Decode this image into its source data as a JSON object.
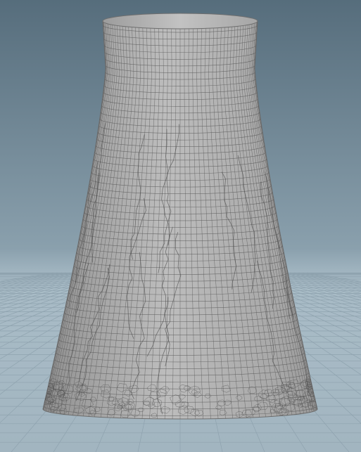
{
  "viewport": {
    "background_top": "#5f7685",
    "background_horizon": "#a9bcc7",
    "ground": "#a9bbc5",
    "grid_line": "#8ea2ae",
    "object_fill_light": "#b9b9b9",
    "object_fill_mid": "#a4a4a4",
    "object_fill_dark": "#8c8c8c",
    "wireframe": "#5b5b5b",
    "object_name": "cooling-tower",
    "object_shading": "smooth-shaded-with-wireframe"
  }
}
